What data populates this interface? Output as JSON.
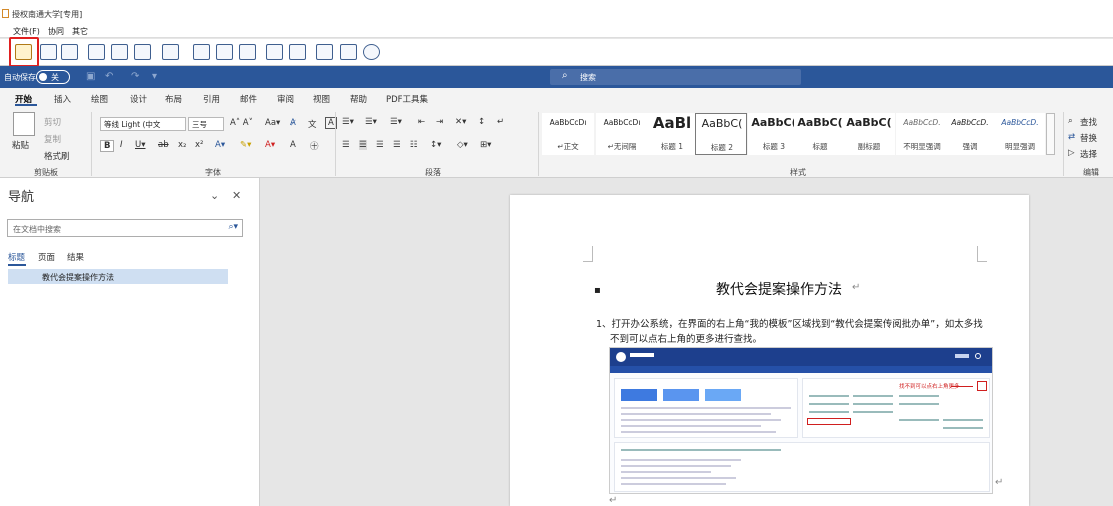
{
  "window": {
    "title": "授权南通大学[专用]"
  },
  "menu": [
    "文件(F)",
    "协同",
    "其它"
  ],
  "quick_access": {
    "autosave_label": "自动保存",
    "toggle_state": "关",
    "search_placeholder": "搜索"
  },
  "tabs": [
    "开始",
    "插入",
    "绘图",
    "设计",
    "布局",
    "引用",
    "邮件",
    "审阅",
    "视图",
    "帮助",
    "PDF工具集"
  ],
  "ribbon": {
    "clipboard": {
      "paste": "粘贴",
      "cut": "剪切",
      "copy": "复制",
      "format_painter": "格式刷",
      "group_label": "剪贴板"
    },
    "font": {
      "font_name": "等线 Light (中文",
      "font_size": "三号",
      "group_label": "字体"
    },
    "paragraph": {
      "group_label": "段落"
    },
    "styles": {
      "items": [
        {
          "preview": "AaBbCcDı",
          "name": "↵正文"
        },
        {
          "preview": "AaBbCcDı",
          "name": "↵无间隔"
        },
        {
          "preview": "AaBl",
          "name": "标题 1"
        },
        {
          "preview": "AaBbC(",
          "name": "标题 2",
          "selected": true
        },
        {
          "preview": "AaBbC(",
          "name": "标题 3"
        },
        {
          "preview": "AaBbC(",
          "name": "标题"
        },
        {
          "preview": "AaBbC(",
          "name": "副标题"
        },
        {
          "preview": "AaBbCcD.",
          "name": "不明显强调"
        },
        {
          "preview": "AaBbCcD.",
          "name": "强调"
        },
        {
          "preview": "AaBbCcD.",
          "name": "明显强调"
        }
      ],
      "group_label": "样式"
    },
    "editing": {
      "find": "查找",
      "replace": "替换",
      "select": "选择",
      "group_label": "编辑"
    }
  },
  "nav_pane": {
    "title": "导航",
    "search_placeholder": "在文档中搜索",
    "tabs": [
      "标题",
      "页面",
      "结果"
    ],
    "headings": [
      "教代会提案操作方法"
    ]
  },
  "document": {
    "title": "教代会提案操作方法",
    "para1_line1": "1、打开办公系统，在界面的右上角“我的模板”区域找到“教代会提案传阅批办单”，如太多找",
    "para1_line2": "不到可以点右上角的更多进行查找。",
    "inner_annotation": "找不到可以点右上角更多"
  },
  "colors": {
    "brand_blue": "#2b579a",
    "highlight_red": "#e02020"
  }
}
